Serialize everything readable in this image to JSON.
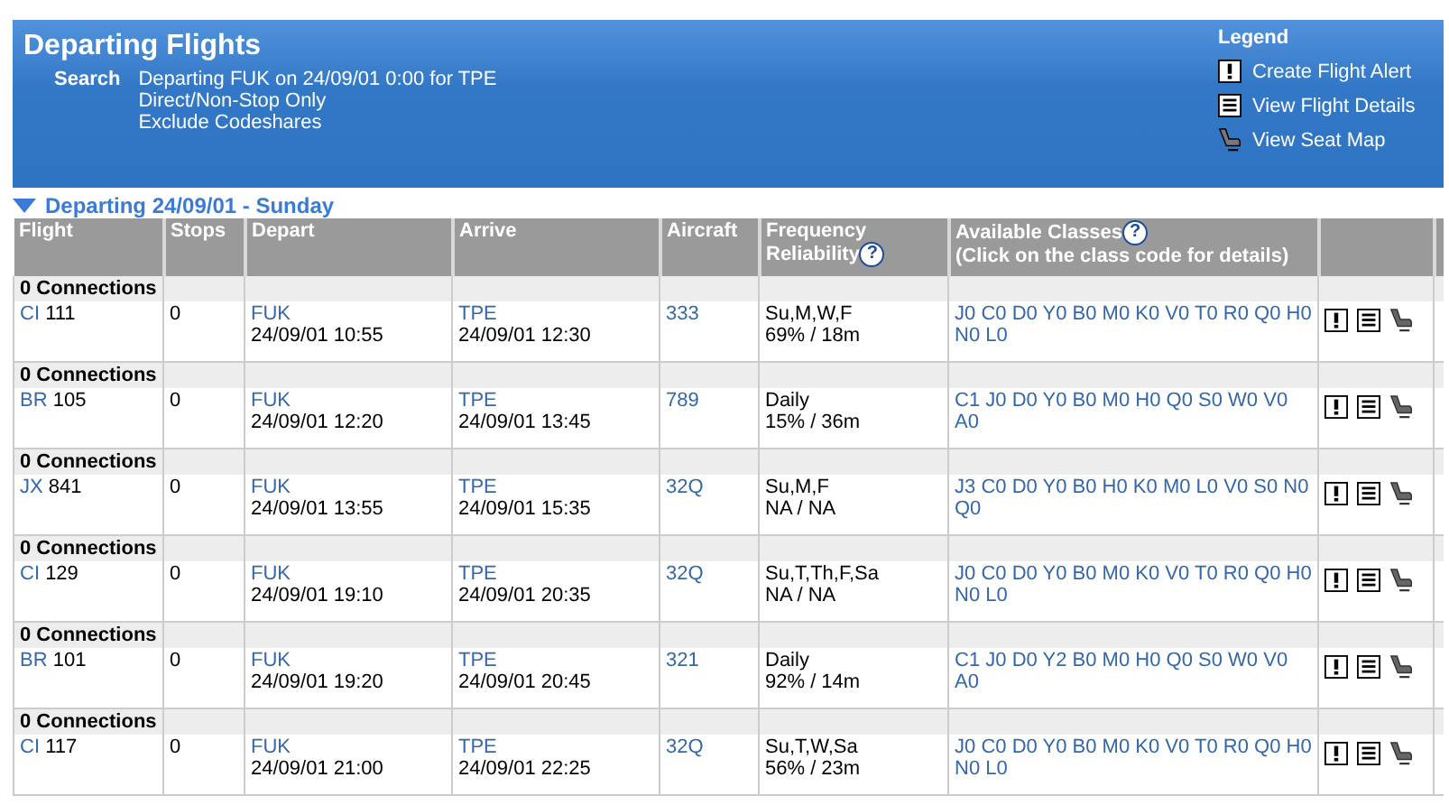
{
  "header": {
    "title": "Departing Flights",
    "search_label": "Search",
    "search_lines": [
      "Departing FUK on 24/09/01 0:00 for TPE",
      "Direct/Non-Stop Only",
      "Exclude Codeshares"
    ],
    "legend": {
      "title": "Legend",
      "items": [
        {
          "kind": "alert",
          "label": "Create Flight Alert"
        },
        {
          "kind": "details",
          "label": "View Flight Details"
        },
        {
          "kind": "seat",
          "label": "View Seat Map"
        }
      ]
    }
  },
  "section": {
    "title": "Departing 24/09/01 - Sunday",
    "expanded": true
  },
  "table": {
    "columns": [
      {
        "label": "Flight"
      },
      {
        "label": "Stops"
      },
      {
        "label": "Depart"
      },
      {
        "label": "Arrive"
      },
      {
        "label": "Aircraft"
      },
      {
        "label": "Frequency",
        "label2": "Reliability",
        "help": "?"
      },
      {
        "label": "Available Classes",
        "label2": "(Click on the class code for details)",
        "help": "?"
      }
    ],
    "rows": [
      {
        "connections": "0 Connections",
        "airline": "CI",
        "number": "111",
        "stops": "0",
        "from": "FUK",
        "depart": "24/09/01 10:55",
        "to": "TPE",
        "arrive": "24/09/01 12:30",
        "aircraft": "333",
        "frequency": "Su,M,W,F",
        "reliability": "69% / 18m",
        "classes": [
          "J0",
          "C0",
          "D0",
          "Y0",
          "B0",
          "M0",
          "K0",
          "V0",
          "T0",
          "R0",
          "Q0",
          "H0",
          "N0",
          "L0"
        ]
      },
      {
        "connections": "0 Connections",
        "airline": "BR",
        "number": "105",
        "stops": "0",
        "from": "FUK",
        "depart": "24/09/01 12:20",
        "to": "TPE",
        "arrive": "24/09/01 13:45",
        "aircraft": "789",
        "frequency": "Daily",
        "reliability": "15% / 36m",
        "classes": [
          "C1",
          "J0",
          "D0",
          "Y0",
          "B0",
          "M0",
          "H0",
          "Q0",
          "S0",
          "W0",
          "V0",
          "A0"
        ]
      },
      {
        "connections": "0 Connections",
        "airline": "JX",
        "number": "841",
        "stops": "0",
        "from": "FUK",
        "depart": "24/09/01 13:55",
        "to": "TPE",
        "arrive": "24/09/01 15:35",
        "aircraft": "32Q",
        "frequency": "Su,M,F",
        "reliability": "NA / NA",
        "classes": [
          "J3",
          "C0",
          "D0",
          "Y0",
          "B0",
          "H0",
          "K0",
          "M0",
          "L0",
          "V0",
          "S0",
          "N0",
          "Q0"
        ]
      },
      {
        "connections": "0 Connections",
        "airline": "CI",
        "number": "129",
        "stops": "0",
        "from": "FUK",
        "depart": "24/09/01 19:10",
        "to": "TPE",
        "arrive": "24/09/01 20:35",
        "aircraft": "32Q",
        "frequency": "Su,T,Th,F,Sa",
        "reliability": "NA / NA",
        "classes": [
          "J0",
          "C0",
          "D0",
          "Y0",
          "B0",
          "M0",
          "K0",
          "V0",
          "T0",
          "R0",
          "Q0",
          "H0",
          "N0",
          "L0"
        ]
      },
      {
        "connections": "0 Connections",
        "airline": "BR",
        "number": "101",
        "stops": "0",
        "from": "FUK",
        "depart": "24/09/01 19:20",
        "to": "TPE",
        "arrive": "24/09/01 20:45",
        "aircraft": "321",
        "frequency": "Daily",
        "reliability": "92% / 14m",
        "classes": [
          "C1",
          "J0",
          "D0",
          "Y2",
          "B0",
          "M0",
          "H0",
          "Q0",
          "S0",
          "W0",
          "V0",
          "A0"
        ]
      },
      {
        "connections": "0 Connections",
        "airline": "CI",
        "number": "117",
        "stops": "0",
        "from": "FUK",
        "depart": "24/09/01 21:00",
        "to": "TPE",
        "arrive": "24/09/01 22:25",
        "aircraft": "32Q",
        "frequency": "Su,T,W,Sa",
        "reliability": "56% / 23m",
        "classes": [
          "J0",
          "C0",
          "D0",
          "Y0",
          "B0",
          "M0",
          "K0",
          "V0",
          "T0",
          "R0",
          "Q0",
          "H0",
          "N0",
          "L0"
        ]
      }
    ]
  }
}
